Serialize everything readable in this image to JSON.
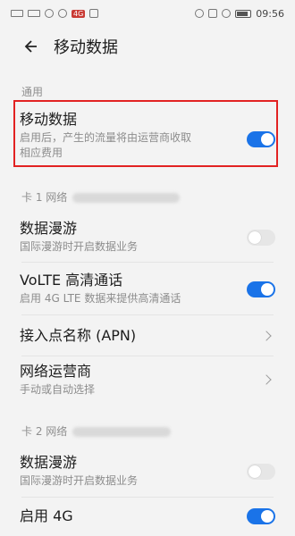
{
  "status_bar": {
    "time": "09:56",
    "badge": "4G"
  },
  "header": {
    "title": "移动数据"
  },
  "sections": {
    "general": "通用",
    "card1": "卡 1 网络",
    "card2": "卡 2 网络"
  },
  "rows": {
    "mobile_data": {
      "title": "移动数据",
      "subtitle_line1": "启用后，产生的流量将由运营商收取",
      "subtitle_line2": "相应费用",
      "enabled": true
    },
    "roaming1": {
      "title": "数据漫游",
      "subtitle": "国际漫游时开启数据业务",
      "enabled": false
    },
    "volte": {
      "title": "VoLTE 高清通话",
      "subtitle": "启用 4G LTE 数据来提供高清通话",
      "enabled": true
    },
    "apn": {
      "title": "接入点名称 (APN)"
    },
    "operator": {
      "title": "网络运营商",
      "subtitle": "手动或自动选择"
    },
    "roaming2": {
      "title": "数据漫游",
      "subtitle": "国际漫游时开启数据业务",
      "enabled": false
    },
    "enable4g": {
      "title": "启用 4G",
      "enabled": true
    }
  },
  "colors": {
    "accent": "#1a73e8",
    "highlight": "#e22222"
  }
}
